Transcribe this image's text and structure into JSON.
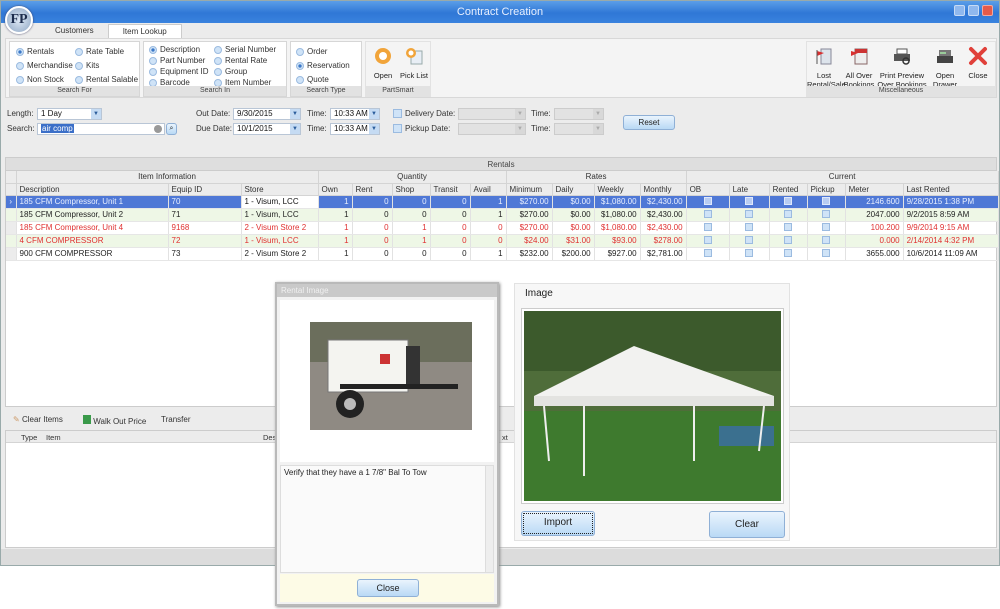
{
  "window": {
    "title": "Contract Creation",
    "logo_text": "FP"
  },
  "tabs": [
    {
      "label": "Customers",
      "active": false
    },
    {
      "label": "Item Lookup",
      "active": true
    }
  ],
  "ribbon": {
    "search_for": {
      "label": "Search For",
      "options": [
        {
          "label": "Rentals",
          "selected": true
        },
        {
          "label": "Merchandise",
          "selected": false
        },
        {
          "label": "Non Stock",
          "selected": false
        },
        {
          "label": "Rate Table",
          "selected": false
        },
        {
          "label": "Kits",
          "selected": false
        },
        {
          "label": "Rental Salable",
          "selected": false
        }
      ]
    },
    "search_in": {
      "label": "Search In",
      "options": [
        {
          "label": "Description",
          "selected": true
        },
        {
          "label": "Part Number",
          "selected": false
        },
        {
          "label": "Equipment ID",
          "selected": false
        },
        {
          "label": "Barcode",
          "selected": false
        },
        {
          "label": "Serial Number",
          "selected": false
        },
        {
          "label": "Rental Rate",
          "selected": false
        },
        {
          "label": "Group",
          "selected": false
        },
        {
          "label": "Item Number",
          "selected": false
        }
      ]
    },
    "search_type": {
      "label": "Search Type",
      "options": [
        {
          "label": "Order",
          "selected": false
        },
        {
          "label": "Reservation",
          "selected": true
        },
        {
          "label": "Quote",
          "selected": false
        }
      ]
    },
    "partsmart": {
      "label": "PartSmart",
      "buttons": [
        {
          "label": "Open",
          "icon": "circle-open-icon"
        },
        {
          "label": "Pick List",
          "icon": "pick-list-icon"
        }
      ]
    },
    "misc": {
      "label": "Miscellaneous",
      "buttons": [
        {
          "label1": "Lost",
          "label2": "Rental/Sale",
          "icon": "flag-document-icon"
        },
        {
          "label1": "All Over",
          "label2": "Bookings",
          "icon": "calendar-flag-icon"
        },
        {
          "label1": "Print Preview",
          "label2": "Over Bookings",
          "icon": "printer-preview-icon"
        },
        {
          "label1": "Open",
          "label2": "Drawer",
          "icon": "cash-register-icon"
        },
        {
          "label1": "Close",
          "label2": "",
          "icon": "close-x-icon"
        }
      ]
    }
  },
  "form": {
    "length_label": "Length:",
    "length_value": "1 Day",
    "search_label": "Search:",
    "search_value": "air comp",
    "out_date_label": "Out Date:",
    "out_date_value": "9/30/2015",
    "due_date_label": "Due Date:",
    "due_date_value": "10/1/2015",
    "time_label": "Time:",
    "out_time_value": "10:33 AM",
    "due_time_value": "10:33 AM",
    "delivery_date_label": "Delivery Date:",
    "pickup_date_label": "Pickup Date:",
    "delivery_time_label": "Time:",
    "pickup_time_label": "Time:",
    "reset_label": "Reset"
  },
  "grid": {
    "title": "Rentals",
    "groups": [
      "Item Information",
      "Quantity",
      "Rates",
      "Current"
    ],
    "columns": [
      "Description",
      "Equip ID",
      "Store",
      "Own",
      "Rent",
      "Shop",
      "Transit",
      "Avail",
      "Minimum",
      "Daily",
      "Weekly",
      "Monthly",
      "OB",
      "Late",
      "Rented",
      "Pickup",
      "Meter",
      "Last Rented"
    ],
    "rows": [
      {
        "style": "sel",
        "cells": [
          "185 CFM Compressor, Unit 1",
          "70",
          "1 - Visum, LCC",
          "1",
          "0",
          "0",
          "0",
          "1",
          "$270.00",
          "$0.00",
          "$1,080.00",
          "$2,430.00",
          "",
          "",
          "",
          "",
          "2146.600",
          "9/28/2015 1:38 PM"
        ]
      },
      {
        "style": "alt",
        "cells": [
          "185 CFM Compressor, Unit 2",
          "71",
          "1 - Visum, LCC",
          "1",
          "0",
          "0",
          "0",
          "1",
          "$270.00",
          "$0.00",
          "$1,080.00",
          "$2,430.00",
          "",
          "",
          "",
          "",
          "2047.000",
          "9/2/2015 8:59 AM"
        ]
      },
      {
        "style": "red",
        "cells": [
          "185 CFM Compressor, Unit 4",
          "9168",
          "2 - Visum Store 2",
          "1",
          "0",
          "1",
          "0",
          "0",
          "$270.00",
          "$0.00",
          "$1,080.00",
          "$2,430.00",
          "",
          "",
          "",
          "",
          "100.200",
          "9/9/2014 9:15 AM"
        ]
      },
      {
        "style": "alt red",
        "cells": [
          "4 CFM COMPRESSOR",
          "72",
          "1 - Visum, LCC",
          "1",
          "0",
          "1",
          "0",
          "0",
          "$24.00",
          "$31.00",
          "$93.00",
          "$278.00",
          "",
          "",
          "",
          "",
          "0.000",
          "2/14/2014 4:32 PM"
        ]
      },
      {
        "style": "",
        "cells": [
          "900 CFM COMPRESSOR",
          "73",
          "2 - Visum Store 2",
          "1",
          "0",
          "0",
          "0",
          "1",
          "$232.00",
          "$200.00",
          "$927.00",
          "$2,781.00",
          "",
          "",
          "",
          "",
          "3655.000",
          "10/6/2014 11:09 AM"
        ]
      }
    ]
  },
  "bottom": {
    "clear_items": "Clear Items",
    "walk_out_price": "Walk Out Price",
    "transfer": "Transfer",
    "col_type": "Type",
    "col_item": "Item",
    "col_desc": "Des",
    "col_ext": "xt"
  },
  "rental_image_dialog": {
    "title": "Rental Image",
    "note": "Verify that they have a 1 7/8\" Bal To Tow",
    "close_label": "Close"
  },
  "image_panel": {
    "title": "Image",
    "import_label": "Import",
    "clear_label": "Clear"
  }
}
